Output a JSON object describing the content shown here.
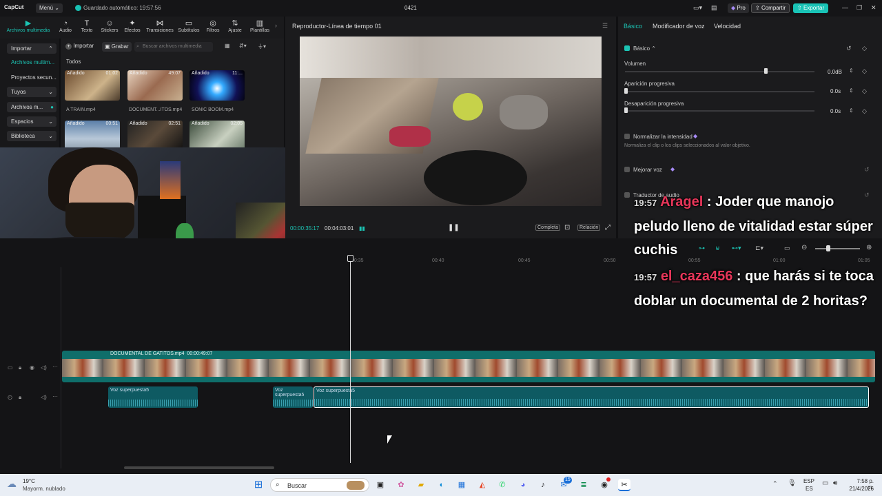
{
  "titlebar": {
    "logo": "CapCut",
    "menu": "Menú",
    "autosave": "Guardado automático: 19:57:56",
    "project": "0421",
    "pro": "Pro",
    "share": "Compartir",
    "export": "Exportar"
  },
  "toolbar": {
    "items": [
      "Archivos multimedia",
      "Audio",
      "Texto",
      "Stickers",
      "Efectos",
      "Transiciones",
      "Subtítulos",
      "Filtros",
      "Ajuste",
      "Plantillas"
    ]
  },
  "leftnav": {
    "items": [
      "Importar",
      "Archivos multim...",
      "Proyectos secun...",
      "Tuyos",
      "Archivos m...",
      "Espacios",
      "Biblioteca"
    ]
  },
  "media": {
    "import": "Importar",
    "record": "Grabar",
    "search_placeholder": "Buscar archivos multimedia",
    "filter": "Todos",
    "tag": "Añadido",
    "items": [
      {
        "name": "A TRAIN.mp4",
        "dur": "01:02"
      },
      {
        "name": "DOCUMENT...ITOS.mp4",
        "dur": "49:07"
      },
      {
        "name": "SONIC BOOM.mp4",
        "dur": "11:..."
      },
      {
        "name": "",
        "dur": "00:51"
      },
      {
        "name": "",
        "dur": "02:51"
      },
      {
        "name": "",
        "dur": "02:05"
      }
    ]
  },
  "player": {
    "title": "Reproductor-Línea de tiempo 01",
    "current": "00:00:35:17",
    "total": "00:04:03:01",
    "full": "Completa",
    "ratio": "Relación"
  },
  "right": {
    "tabs": [
      "Básico",
      "Modificador de voz",
      "Velocidad"
    ],
    "section": "Básico",
    "volume_label": "Volumen",
    "volume_value": "0.0dB",
    "volume_level": 0.74,
    "fadein_label": "Aparición progresiva",
    "fadein_value": "0.0s",
    "fadeout_label": "Desaparición progresiva",
    "fadeout_value": "0.0s",
    "normalize_label": "Normalizar la intensidad",
    "normalize_desc": "Normaliza el clip o los clips seleccionados al valor objetivo.",
    "enhance_label": "Mejorar voz",
    "translate_label": "Traductor de audio"
  },
  "timeline": {
    "ticks": [
      "00:35",
      "00:40",
      "00:45",
      "00:50",
      "00:55",
      "01:00",
      "01:05"
    ],
    "video_clip": "DOCUMENTAL DE GATITOS.mp4",
    "video_dur": "00:00:49:07",
    "audio_label": "Voz superpuesta5"
  },
  "chat": [
    {
      "time": "19:57",
      "user": "Aragel",
      "text": ": Joder que manojo peludo lleno de vitalidad estar súper cuchis"
    },
    {
      "time": "19:57",
      "user": "el_caza456",
      "text": ": que harás si te toca doblar un documental de 2 horitas?"
    }
  ],
  "taskbar": {
    "temp": "19°C",
    "weather": "Mayorm. nublado",
    "search": "Buscar",
    "lang1": "ESP",
    "lang2": "ES",
    "time": "7:58 p. m.",
    "date": "21/4/2026",
    "badge": "15"
  }
}
